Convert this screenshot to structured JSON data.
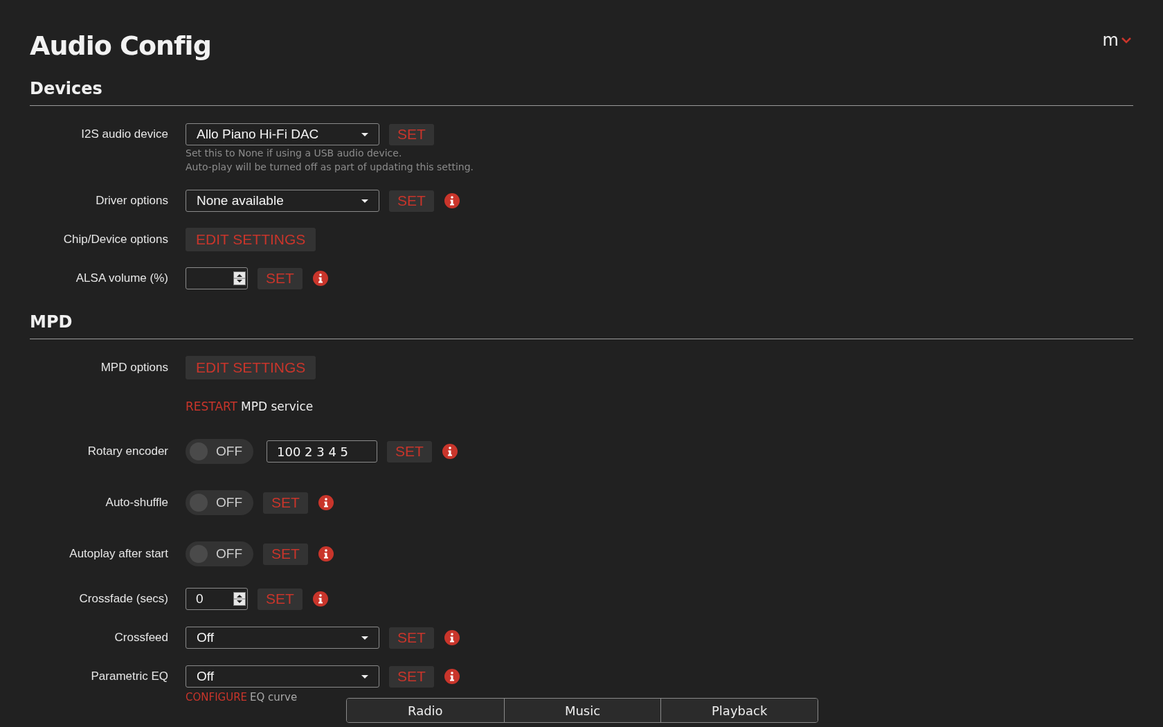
{
  "page": {
    "title": "Audio Config",
    "menu_label": "m"
  },
  "sections": [
    {
      "heading": "Devices",
      "rows": [
        {
          "kind": "select",
          "label": "I2S audio device",
          "value": "Allo Piano Hi-Fi DAC",
          "button": "SET",
          "info": false,
          "hints": [
            "Set this to None if using a USB audio device.",
            "Auto-play will be turned off as part of updating this setting."
          ]
        },
        {
          "kind": "select",
          "label": "Driver options",
          "value": "None available",
          "button": "SET",
          "info": true
        },
        {
          "kind": "edit",
          "label": "Chip/Device options",
          "button": "EDIT SETTINGS"
        },
        {
          "kind": "number",
          "label": "ALSA volume (%)",
          "value": "",
          "button": "SET",
          "info": true
        }
      ]
    },
    {
      "heading": "MPD",
      "rows": [
        {
          "kind": "edit",
          "label": "MPD options",
          "button": "EDIT SETTINGS"
        },
        {
          "kind": "link",
          "link": "RESTART",
          "text": "MPD service"
        },
        {
          "kind": "toggle",
          "label": "Rotary encoder",
          "on": false,
          "state_text": "OFF",
          "value": "100 2 3 4 5",
          "button": "SET",
          "info": true
        },
        {
          "kind": "toggle",
          "label": "Auto-shuffle",
          "on": false,
          "state_text": "OFF",
          "button": "SET",
          "info": true
        },
        {
          "kind": "toggle",
          "label": "Autoplay after start",
          "on": false,
          "state_text": "OFF",
          "button": "SET",
          "info": true
        },
        {
          "kind": "number",
          "label": "Crossfade (secs)",
          "value": "0",
          "button": "SET",
          "info": true
        },
        {
          "kind": "select",
          "label": "Crossfeed",
          "value": "Off",
          "button": "SET",
          "info": true
        },
        {
          "kind": "select",
          "label": "Parametric EQ",
          "value": "Off",
          "button": "SET",
          "info": true,
          "sublink": {
            "link": "CONFIGURE",
            "text": "EQ curve"
          }
        }
      ]
    }
  ],
  "footer_tabs": [
    {
      "label": "Radio"
    },
    {
      "label": "Music"
    },
    {
      "label": "Playback"
    }
  ]
}
